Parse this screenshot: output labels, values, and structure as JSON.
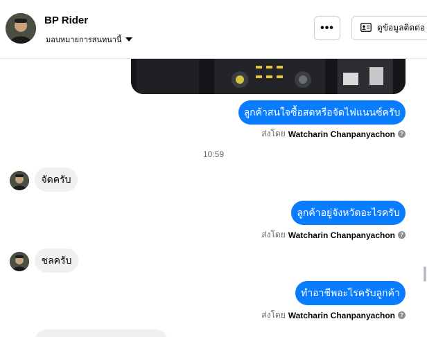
{
  "header": {
    "name": "BP Rider",
    "assign_label": "มอบหมายการสนทนานี้",
    "more_label": "•••",
    "contact_label": "ดูข้อมูลติดต่อ"
  },
  "thread": {
    "messages": [
      {
        "direction": "out",
        "text": "ลูกค้าสนใจซื้อสดหรือจัดไฟแนนซ์ครับ",
        "sent_by_prefix": "ส่งโดย",
        "sent_by_name": "Watcharin Chanpanyachon"
      },
      {
        "direction": "in",
        "text": "จัดครับ"
      },
      {
        "direction": "out",
        "text": "ลูกค้าอยู่จังหวัดอะไรครับ",
        "sent_by_prefix": "ส่งโดย",
        "sent_by_name": "Watcharin Chanpanyachon"
      },
      {
        "direction": "in",
        "text": "ชลครับ"
      },
      {
        "direction": "out",
        "text": "ทำอาชีพอะไรครับลูกค้า",
        "sent_by_prefix": "ส่งโดย",
        "sent_by_name": "Watcharin Chanpanyachon"
      }
    ],
    "timestamp": "10:59"
  },
  "colors": {
    "outgoing_bubble": "#0a7cff",
    "incoming_bubble": "#f0f0f0",
    "muted_text": "#65676b"
  },
  "icons": {
    "more": "more-dots-icon",
    "contact": "contact-card-icon",
    "dropdown": "caret-down-icon",
    "info": "question-icon"
  }
}
